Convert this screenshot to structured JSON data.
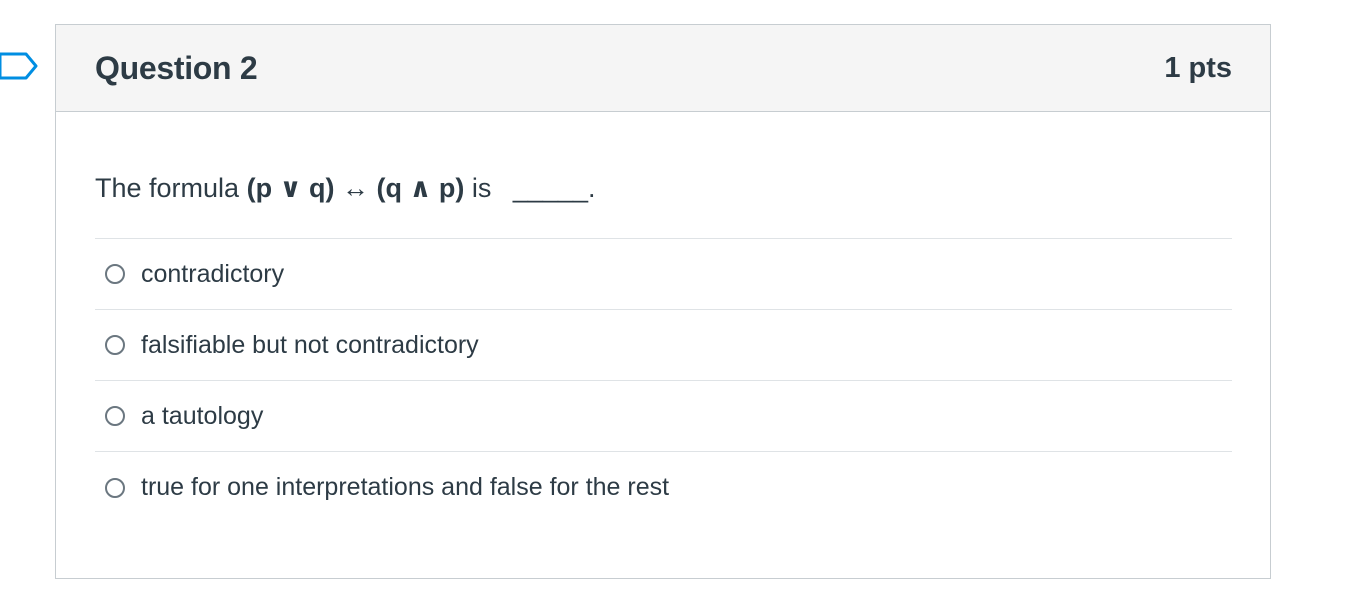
{
  "question": {
    "title": "Question 2",
    "points": "1 pts",
    "text_prefix": "The formula",
    "formula": "(p ∨ q) ↔ (q ∧ p)",
    "text_suffix": "is",
    "blank": "_____."
  },
  "answers": [
    {
      "label": "contradictory",
      "selected": false
    },
    {
      "label": "falsifiable but not contradictory",
      "selected": false
    },
    {
      "label": "a tautology",
      "selected": false
    },
    {
      "label": "true for one interpretations and false for the rest",
      "selected": false
    }
  ],
  "icons": {
    "flag": "flag-outline-icon"
  },
  "colors": {
    "text": "#2d3b45",
    "header_bg": "#f5f5f5",
    "border": "#c7cdd1",
    "flag_stroke": "#008ee2"
  }
}
